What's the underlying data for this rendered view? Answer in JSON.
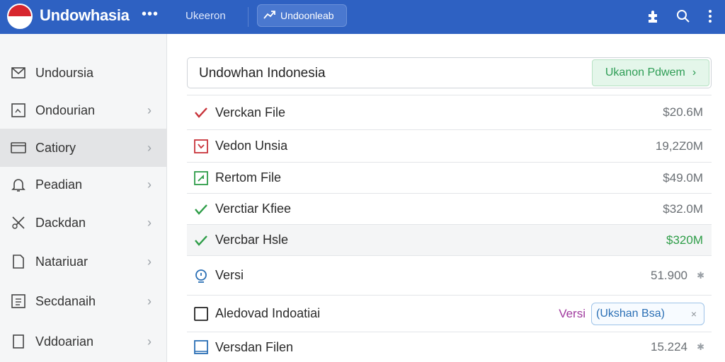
{
  "header": {
    "app_title": "Undowhasia",
    "menu_dots": "•••",
    "nav_link": "Ukeeron",
    "pill_label": "Undoonleab"
  },
  "sidebar": {
    "items": [
      {
        "label": "Undoursia",
        "icon": "mail-icon",
        "chevron": ""
      },
      {
        "label": "Ondourian",
        "icon": "image-box-icon",
        "chevron": "›"
      },
      {
        "label": "Catiory",
        "icon": "folder-icon",
        "chevron": "›"
      },
      {
        "label": "Peadian",
        "icon": "bell-icon",
        "chevron": "›"
      },
      {
        "label": "Dackdan",
        "icon": "tools-icon",
        "chevron": "›"
      },
      {
        "label": "Natariuar",
        "icon": "document-icon",
        "chevron": "›"
      },
      {
        "label": "Secdanaih",
        "icon": "list-box-icon",
        "chevron": "›"
      },
      {
        "label": "Vddoarian",
        "icon": "page-icon",
        "chevron": "›"
      }
    ]
  },
  "search": {
    "value": "Undowhan Indonesia",
    "button_label": "Ukanon Pdwem",
    "button_chevron": "›"
  },
  "files": [
    {
      "label": "Verckan File",
      "size": "$20.6M",
      "icon": "red-check-icon"
    },
    {
      "label": "Vedon Unsia",
      "size": "19,2Z0M",
      "icon": "red-box-icon"
    },
    {
      "label": "Rertom File",
      "size": "$49.0M",
      "icon": "green-box-icon"
    },
    {
      "label": "Verctiar Kfiee",
      "size": "$32.0M",
      "icon": "green-check-icon"
    },
    {
      "label": "Vercbar Hsle",
      "size": "$320M",
      "icon": "green-check-icon"
    },
    {
      "label": "Versi",
      "size": "51.900",
      "icon": "blue-circle-icon",
      "mark": "✱"
    },
    {
      "label": "Aledovad Indoatiai",
      "tag": "Versi",
      "chip_label": "(Ukshan Bsa)",
      "chip_close": "×",
      "icon": "square-icon"
    },
    {
      "label": "Versdan Filen",
      "size": "15.224",
      "icon": "blue-box-icon",
      "mark": "✱"
    }
  ],
  "colors": {
    "header_bg": "#2e61c2",
    "accent_green": "#2e9d55",
    "sidebar_bg": "#f5f6f7"
  }
}
